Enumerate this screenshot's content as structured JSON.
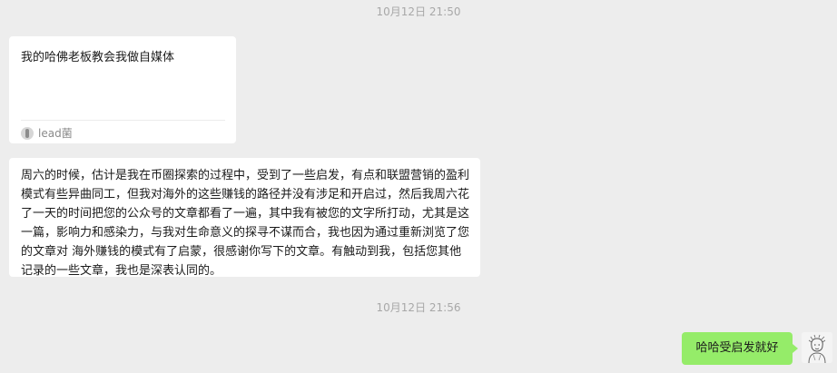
{
  "chat": {
    "timestamps": [
      "10月12日 21:50",
      "10月12日 21:56"
    ],
    "link_card": {
      "title": "我的哈佛老板教会我做自媒体",
      "source_icon": "article-source-icon",
      "source_name": "lead菌"
    },
    "incoming_text": "周六的时候，估计是我在币圈探索的过程中，受到了一些启发，有点和联盟营销的盈利模式有些异曲同工，但我对海外的这些赚钱的路径并没有涉足和开启过，然后我周六花了一天的时间把您的公众号的文章都看了一遍，其中我有被您的文字所打动，尤其是这一篇，影响力和感染力，与我对生命意义的探寻不谋而合，我也因为通过重新浏览了您的文章对 海外赚钱的模式有了启蒙，很感谢你写下的文章。有触动到我，包括您其他记录的一些文章，我也是深表认同的。",
    "outgoing_text": "哈哈受启发就好",
    "colors": {
      "background": "#ededed",
      "incoming_bubble": "#ffffff",
      "outgoing_bubble": "#95ec69",
      "timestamp": "#a8a8a8"
    },
    "avatar_icon": "user-avatar-sketch"
  }
}
